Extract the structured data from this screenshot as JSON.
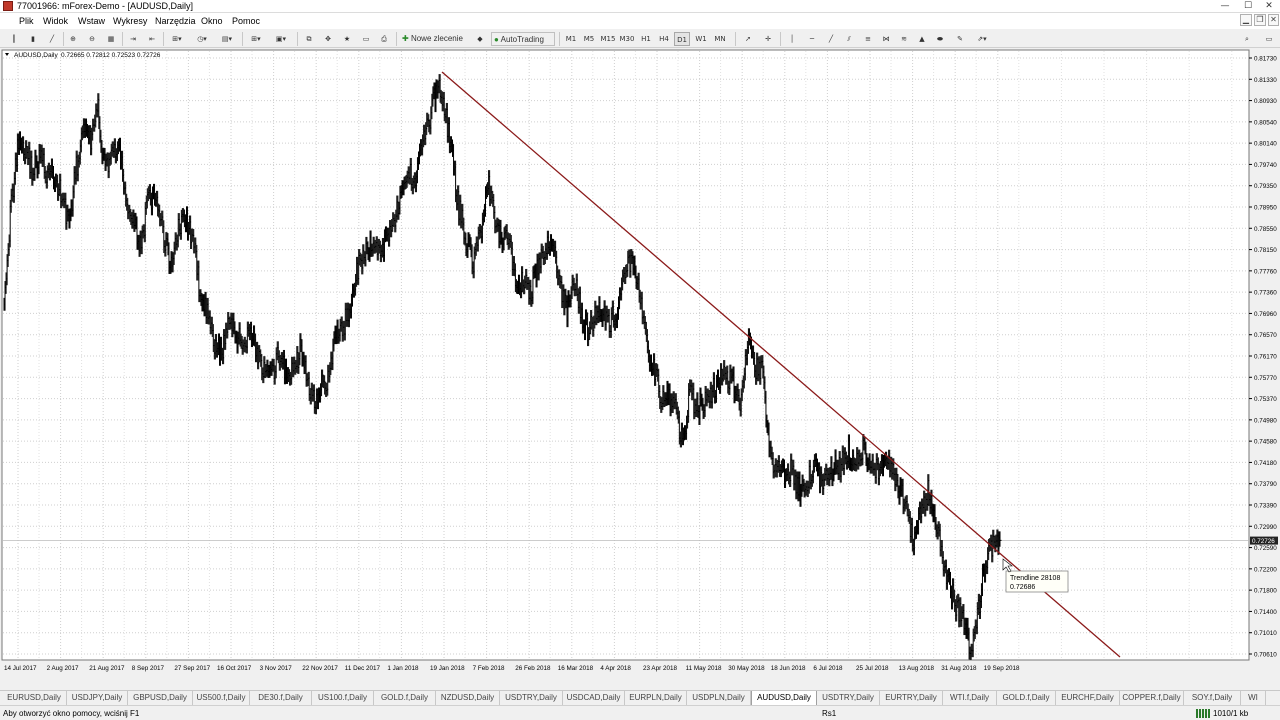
{
  "window": {
    "title": "77001966: mForex-Demo - [AUDUSD,Daily]",
    "minimize": "—",
    "maximize": "☐",
    "close": "✕"
  },
  "menu": [
    "Plik",
    "Widok",
    "Wstaw",
    "Wykresy",
    "Narzędzia",
    "Okno",
    "Pomoc"
  ],
  "toolbar": {
    "new_order": "Nowe zlecenie",
    "autotrading": "AutoTrading",
    "timeframes": [
      "M1",
      "M5",
      "M15",
      "M30",
      "H1",
      "H4",
      "D1",
      "W1",
      "MN"
    ],
    "active_timeframe": "D1"
  },
  "chart_data": {
    "type": "line",
    "symbol_label": "AUDUSD,Daily",
    "ohlc_label": "0.72665 0.72812 0.72523 0.72726",
    "series": [
      {
        "values": [
          0.7736,
          0.7898,
          0.8024,
          0.8005,
          0.7962,
          0.799,
          0.7955,
          0.795,
          0.7916,
          0.7865,
          0.7967,
          0.8034,
          0.8018,
          0.8073,
          0.796,
          0.8008,
          0.7993,
          0.7903,
          0.7854,
          0.7827,
          0.791,
          0.7905,
          0.7851,
          0.7786,
          0.7848,
          0.7877,
          0.7843,
          0.7752,
          0.7704,
          0.764,
          0.7619,
          0.7677,
          0.7662,
          0.7635,
          0.7672,
          0.7628,
          0.7583,
          0.7573,
          0.7617,
          0.7588,
          0.7585,
          0.7628,
          0.7575,
          0.7534,
          0.7571,
          0.7566,
          0.7661,
          0.767,
          0.7715,
          0.7779,
          0.7805,
          0.7832,
          0.7806,
          0.784,
          0.7874,
          0.7907,
          0.796,
          0.7947,
          0.8027,
          0.8057,
          0.8124,
          0.8086,
          0.7995,
          0.7894,
          0.7834,
          0.7793,
          0.7844,
          0.7941,
          0.7863,
          0.7829,
          0.784,
          0.7745,
          0.7759,
          0.7742,
          0.7784,
          0.7812,
          0.7839,
          0.7747,
          0.7697,
          0.7761,
          0.7694,
          0.7662,
          0.7705,
          0.7704,
          0.7681,
          0.7702,
          0.7764,
          0.7807,
          0.7731,
          0.7636,
          0.7596,
          0.7539,
          0.7536,
          0.7525,
          0.745,
          0.755,
          0.7518,
          0.7531,
          0.7551,
          0.7566,
          0.7586,
          0.7566,
          0.7535,
          0.7648,
          0.7589,
          0.7589,
          0.7447,
          0.7399,
          0.7402,
          0.7403,
          0.7371,
          0.7362,
          0.7412,
          0.7394,
          0.7388,
          0.7409,
          0.7416,
          0.744,
          0.7418,
          0.7437,
          0.742,
          0.7404,
          0.7402,
          0.7416,
          0.7374,
          0.7335,
          0.7266,
          0.733,
          0.7365,
          0.7315,
          0.7244,
          0.7188,
          0.7146,
          0.713,
          0.7065,
          0.7147,
          0.724,
          0.7267,
          0.7273
        ]
      }
    ],
    "x_tick_labels": [
      "14 Jul 2017",
      "2 Aug 2017",
      "21 Aug 2017",
      "8 Sep 2017",
      "27 Sep 2017",
      "16 Oct 2017",
      "3 Nov 2017",
      "22 Nov 2017",
      "11 Dec 2017",
      "1 Jan 2018",
      "19 Jan 2018",
      "7 Feb 2018",
      "26 Feb 2018",
      "16 Mar 2018",
      "4 Apr 2018",
      "23 Apr 2018",
      "11 May 2018",
      "30 May 2018",
      "18 Jun 2018",
      "6 Jul 2018",
      "25 Jul 2018",
      "13 Aug 2018",
      "31 Aug 2018",
      "19 Sep 2018"
    ],
    "y_tick_labels": [
      "0.81730",
      "0.81330",
      "0.80930",
      "0.80540",
      "0.80140",
      "0.79740",
      "0.79350",
      "0.78950",
      "0.78550",
      "0.78150",
      "0.77760",
      "0.77360",
      "0.76960",
      "0.76570",
      "0.76170",
      "0.75770",
      "0.75370",
      "0.74980",
      "0.74580",
      "0.74180",
      "0.73790",
      "0.73390",
      "0.72990",
      "0.72590",
      "0.72200",
      "0.71800",
      "0.71400",
      "0.71010",
      "0.70610"
    ],
    "ylim": [
      0.7061,
      0.8173
    ],
    "current_price": "0.72726",
    "trendline": {
      "name": "Trendline 28108",
      "value": "0.72686",
      "color": "#8b1a1a"
    },
    "grid": true,
    "colors": {
      "background": "#ffffff",
      "bars": "#000000",
      "grid": "#d8d8d8",
      "price_marker": "#222222"
    }
  },
  "tabs": [
    "EURUSD,Daily",
    "USDJPY,Daily",
    "GBPUSD,Daily",
    "US500.f,Daily",
    "DE30.f,Daily",
    "US100.f,Daily",
    "GOLD.f,Daily",
    "NZDUSD,Daily",
    "USDTRY,Daily",
    "USDCAD,Daily",
    "EURPLN,Daily",
    "USDPLN,Daily",
    "AUDUSD,Daily",
    "USDTRY,Daily",
    "EURTRY,Daily",
    "WTI.f,Daily",
    "GOLD.f,Daily",
    "EURCHF,Daily",
    "COPPER.f,Daily",
    "SOY.f,Daily",
    "WI"
  ],
  "active_tab": "AUDUSD,Daily",
  "status": {
    "help": "Aby otworzyć okno pomocy, wciśnij F1",
    "profile": "Rs1",
    "connection": "1010/1 kb"
  }
}
